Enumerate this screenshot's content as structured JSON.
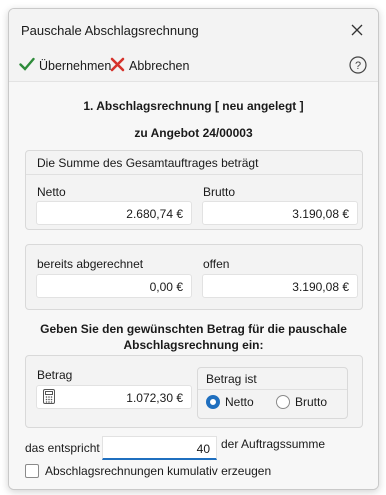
{
  "window": {
    "title": "Pauschale Abschlagsrechnung"
  },
  "toolbar": {
    "ok_label": "Übernehmen",
    "cancel_label": "Abbrechen"
  },
  "header": {
    "line1": "1. Abschlagsrechnung  [ neu angelegt ]",
    "line2": "zu Angebot 24/00003"
  },
  "summary": {
    "title": "Die Summe des Gesamtauftrages beträgt",
    "netto_label": "Netto",
    "netto_value": "2.680,74 €",
    "brutto_label": "Brutto",
    "brutto_value": "3.190,08 €"
  },
  "billing": {
    "billed_label": "bereits abgerechnet",
    "billed_value": "0,00 €",
    "open_label": "offen",
    "open_value": "3.190,08 €"
  },
  "prompt": {
    "line1": "Geben Sie den gewünschten Betrag für die pauschale",
    "line2": "Abschlagsrechnung ein:"
  },
  "amount": {
    "label": "Betrag",
    "value": "1.072,30 €",
    "type_title": "Betrag ist",
    "option_netto": "Netto",
    "option_brutto": "Brutto",
    "selected": "Netto"
  },
  "percent": {
    "prefix": "das entspricht",
    "value": "40",
    "suffix": "der Auftragssumme"
  },
  "cumulative": {
    "label": "Abschlagsrechnungen kumulativ erzeugen",
    "checked": false
  },
  "colors": {
    "accent": "#1f6fbf",
    "ok_green": "#2e8b3a",
    "cancel_red": "#d6322b"
  }
}
